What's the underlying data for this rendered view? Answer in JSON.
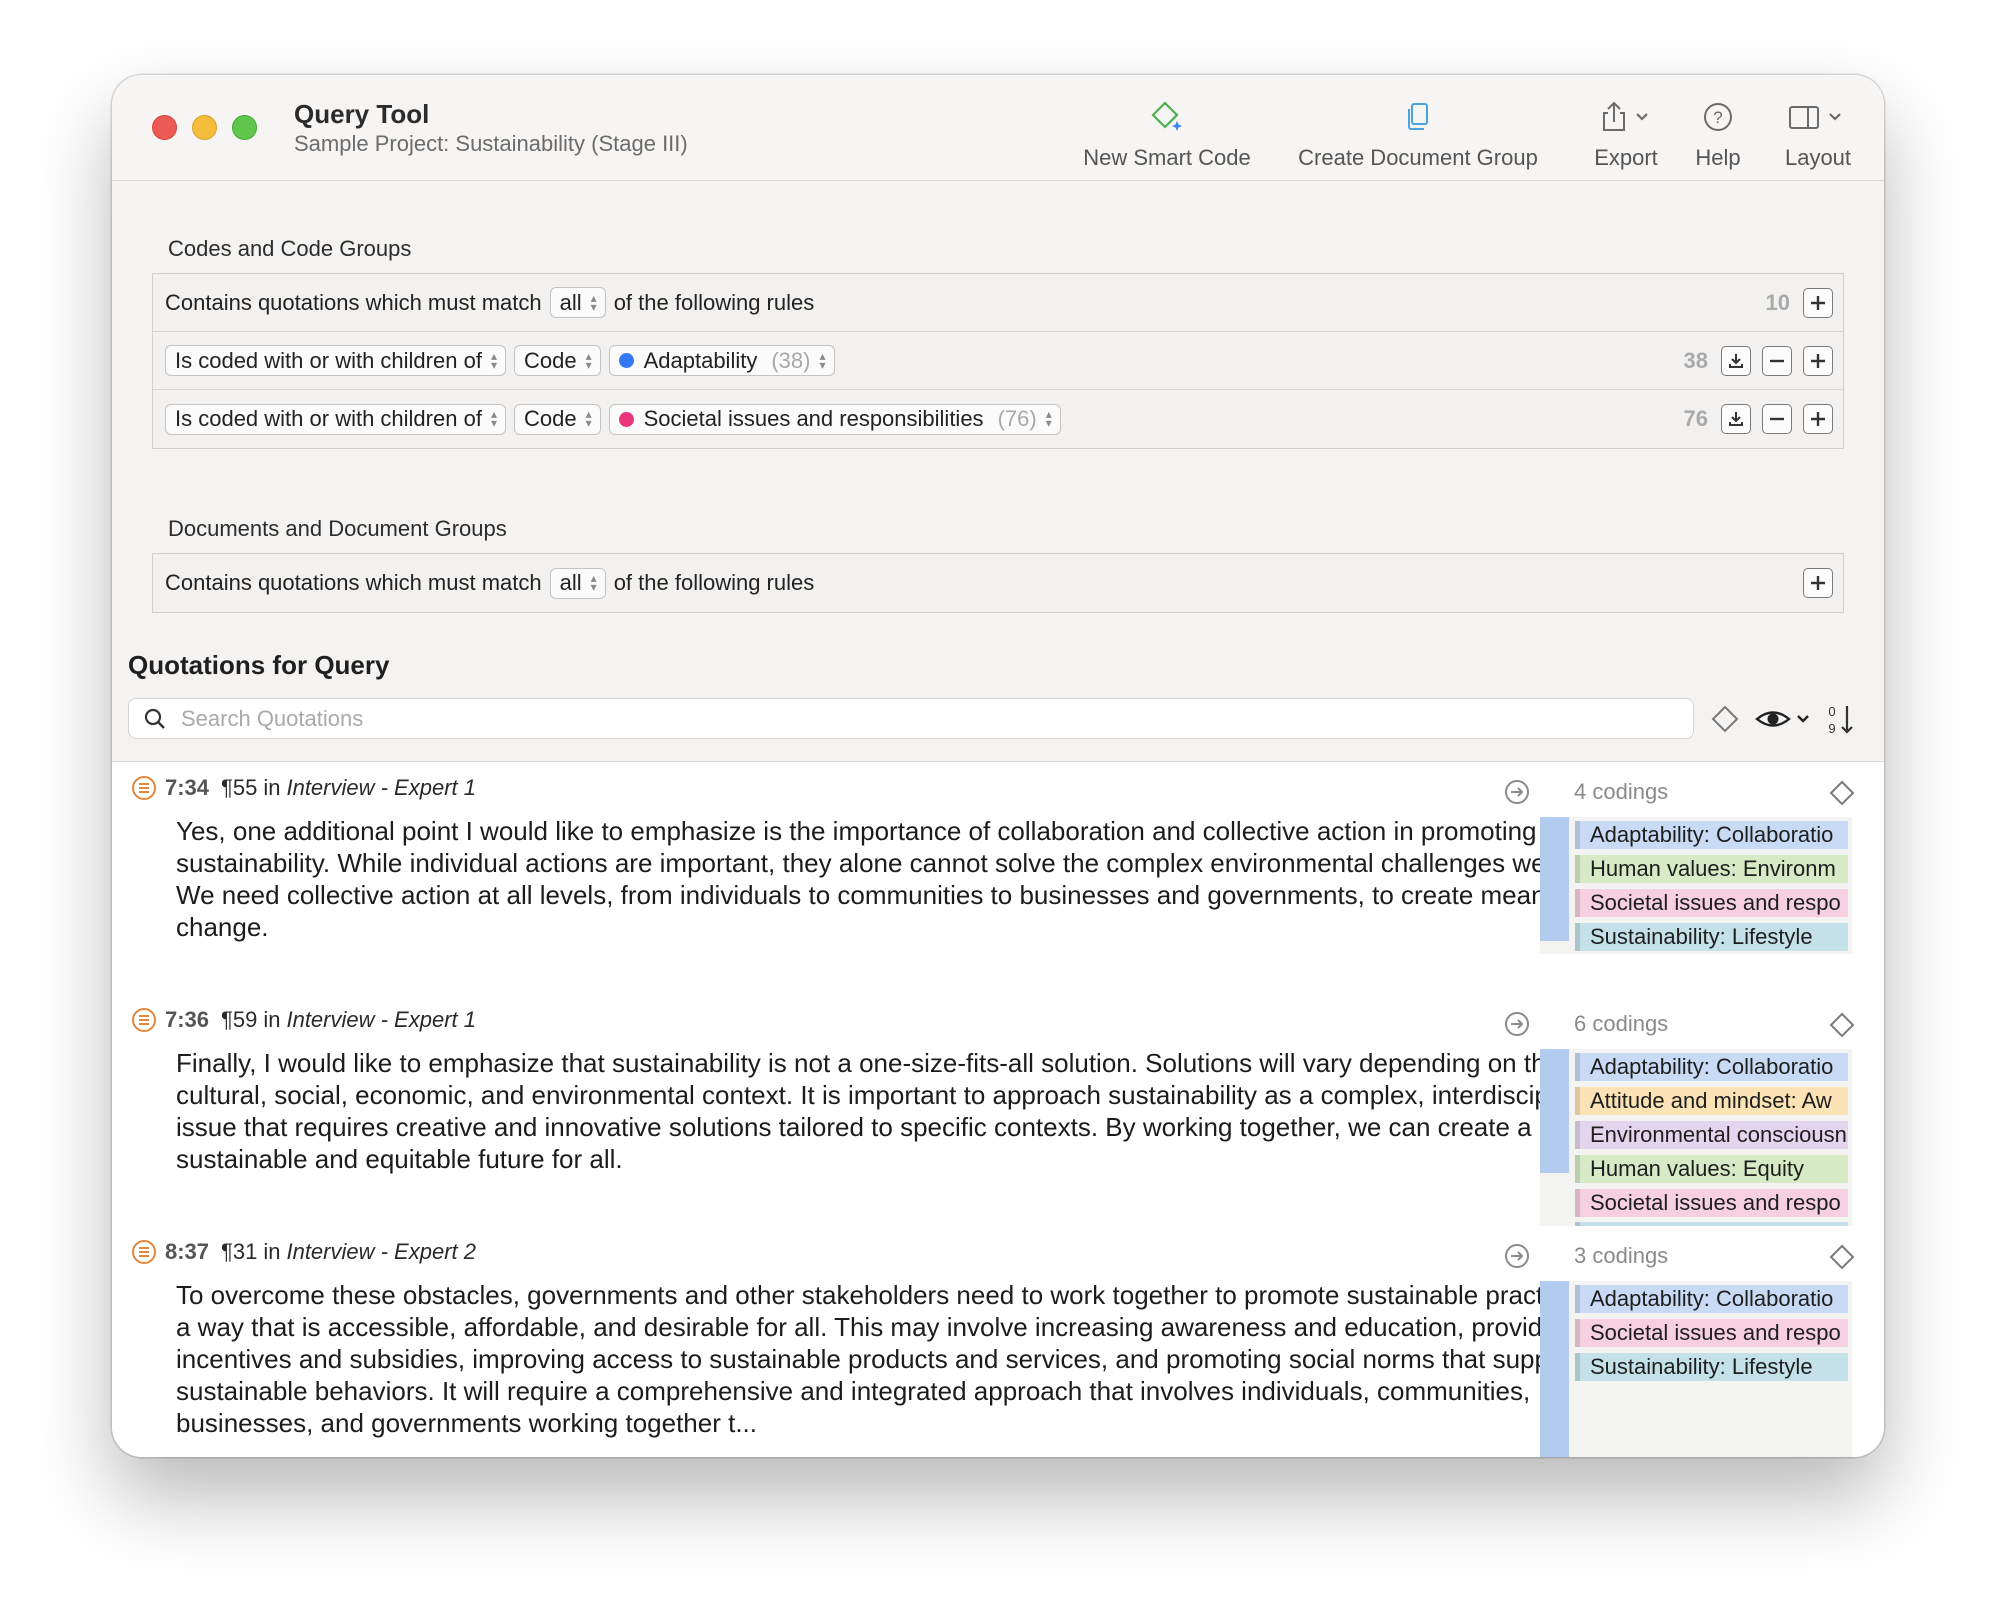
{
  "window": {
    "title": "Query Tool",
    "subtitle": "Sample Project: Sustainability (Stage III)"
  },
  "toolbar": {
    "new_smart_code": "New Smart Code",
    "create_document_group": "Create Document Group",
    "export": "Export",
    "help": "Help",
    "layout": "Layout"
  },
  "codes_section": {
    "title": "Codes and Code Groups",
    "header_row": {
      "prefix": "Contains quotations which must match",
      "match_mode": "all",
      "suffix": "of the following rules",
      "count": "10"
    },
    "rules": [
      {
        "condition": "Is coded with or with children of",
        "type": "Code",
        "code": "Adaptability",
        "code_count": "(38)",
        "color": "#3478f6",
        "count": "38"
      },
      {
        "condition": "Is coded with or with children of",
        "type": "Code",
        "code": "Societal issues and responsibilities",
        "code_count": "(76)",
        "color": "#e8357c",
        "count": "76"
      }
    ]
  },
  "documents_section": {
    "title": "Documents and Document Groups",
    "header_row": {
      "prefix": "Contains quotations which must match",
      "match_mode": "all",
      "suffix": "of the following rules"
    }
  },
  "quotations": {
    "title": "Quotations for Query",
    "search_placeholder": "Search Quotations",
    "items": [
      {
        "id": "7:34",
        "para": "¶55",
        "in": "in",
        "doc": "Interview - Expert 1",
        "text": "Yes, one additional point I would like to emphasize is the importance of collaboration and collective action in promoting sustainability. While individual actions are important, they alone cannot solve the complex environmental challenges we face. We need collective action at all levels, from individuals to communities to businesses and governments, to create meaningful change.",
        "codings_label": "4 codings",
        "codes": [
          {
            "label": "Adaptability: Collaboratio",
            "color": "#c9daf5"
          },
          {
            "label": "Human values: Environm",
            "color": "#d6ebc5"
          },
          {
            "label": "Societal issues and respo",
            "color": "#f6cfe0"
          },
          {
            "label": "Sustainability: Lifestyle",
            "color": "#c4e1ea"
          }
        ]
      },
      {
        "id": "7:36",
        "para": "¶59",
        "in": "in",
        "doc": "Interview - Expert 1",
        "text": "Finally, I would like to emphasize that sustainability is not a one-size-fits-all solution. Solutions will vary depending on the cultural, social, economic, and environmental context. It is important to approach sustainability as a complex, interdisciplinary issue that requires creative and innovative solutions tailored to specific contexts. By working together, we can create a more sustainable and equitable future for all.",
        "codings_label": "6 codings",
        "codes": [
          {
            "label": "Adaptability: Collaboratio",
            "color": "#c9daf5"
          },
          {
            "label": "Attitude and mindset: Aw",
            "color": "#fbe3b5"
          },
          {
            "label": "Environmental consciousn",
            "color": "#e4d5ee"
          },
          {
            "label": "Human values: Equity",
            "color": "#d6ebc5"
          },
          {
            "label": "Societal issues and respo",
            "color": "#f6cfe0"
          }
        ]
      },
      {
        "id": "8:37",
        "para": "¶31",
        "in": "in",
        "doc": "Interview - Expert 2",
        "text": "To overcome these obstacles, governments and other stakeholders need to work together to promote sustainable practices in a way that is accessible, affordable, and desirable for all. This may involve increasing awareness and education, providing incentives and subsidies, improving access to sustainable products and services, and promoting social norms that support sustainable behaviors. It will require a comprehensive and integrated approach that involves individuals, communities, businesses, and governments working together t...",
        "codings_label": "3 codings",
        "codes": [
          {
            "label": "Adaptability: Collaboratio",
            "color": "#c9daf5"
          },
          {
            "label": "Societal issues and respo",
            "color": "#f6cfe0"
          },
          {
            "label": "Sustainability: Lifestyle",
            "color": "#c4e1ea"
          }
        ]
      }
    ]
  }
}
